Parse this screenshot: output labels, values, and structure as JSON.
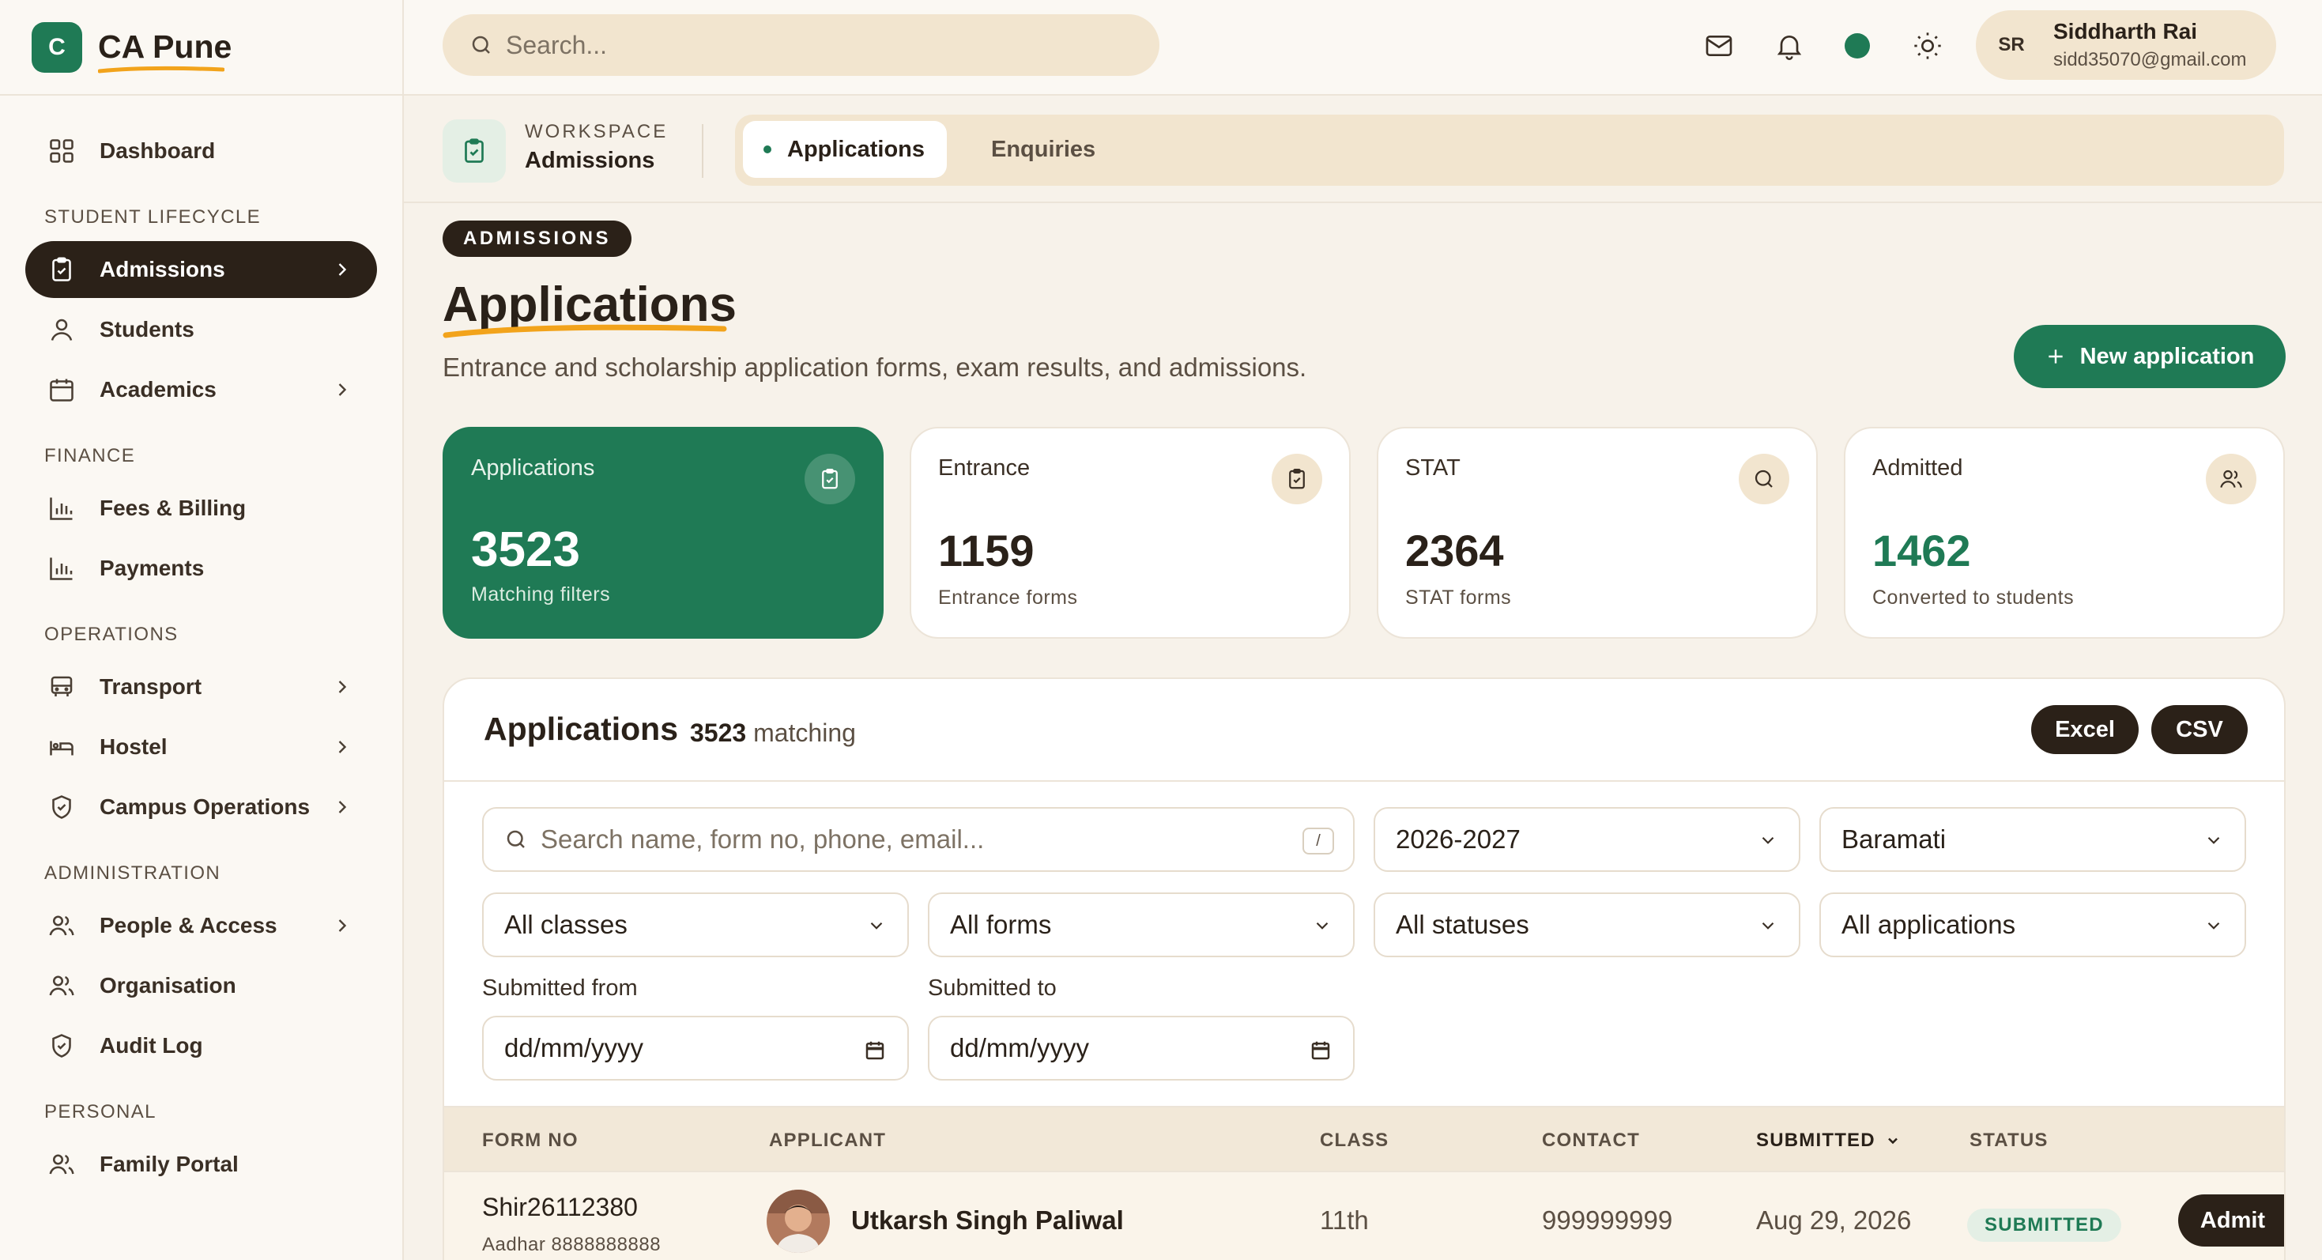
{
  "brand": {
    "logo_letter": "C",
    "name": "CA Pune",
    "accent": "#1f7a55",
    "underline_color": "#f2a31b"
  },
  "sidebar": {
    "dashboard": "Dashboard",
    "sections": {
      "student_lifecycle": "STUDENT LIFECYCLE",
      "finance": "FINANCE",
      "operations": "OPERATIONS",
      "administration": "ADMINISTRATION",
      "personal": "PERSONAL"
    },
    "items": {
      "admissions": "Admissions",
      "students": "Students",
      "academics": "Academics",
      "fees_billing": "Fees & Billing",
      "payments": "Payments",
      "transport": "Transport",
      "hostel": "Hostel",
      "campus_operations": "Campus Operations",
      "people_access": "People & Access",
      "organisation": "Organisation",
      "audit_log": "Audit Log",
      "family_portal": "Family Portal"
    }
  },
  "topbar": {
    "search_placeholder": "Search...",
    "icons": [
      "mail-icon",
      "bell-icon",
      "status-dot",
      "sun-icon"
    ],
    "user": {
      "initials": "SR",
      "name": "Siddharth Rai",
      "email": "sidd35070@gmail.com"
    }
  },
  "workspace": {
    "label": "WORKSPACE",
    "title": "Admissions",
    "tabs": {
      "active": "Applications",
      "other": "Enquiries"
    }
  },
  "page": {
    "badge": "ADMISSIONS",
    "title": "Applications",
    "subtitle": "Entrance and scholarship application forms, exam results, and admissions.",
    "new_button": "New application"
  },
  "stats": [
    {
      "label": "Applications",
      "value": "3523",
      "hint": "Matching filters",
      "icon": "clipboard-check-icon"
    },
    {
      "label": "Entrance",
      "value": "1159",
      "hint": "Entrance forms",
      "icon": "clipboard-check-icon"
    },
    {
      "label": "STAT",
      "value": "2364",
      "hint": "STAT forms",
      "icon": "search-icon"
    },
    {
      "label": "Admitted",
      "value": "1462",
      "hint": "Converted to students",
      "icon": "users-icon"
    }
  ],
  "panel": {
    "title": "Applications",
    "count": "3523",
    "count_suffix": "matching",
    "export_excel": "Excel",
    "export_csv": "CSV",
    "filters": {
      "search_placeholder": "Search name, form no, phone, email...",
      "search_shortcut": "/",
      "year": "2026-2027",
      "campus": "Baramati",
      "classes": "All classes",
      "forms": "All forms",
      "statuses": "All statuses",
      "applications": "All applications",
      "submitted_from_label": "Submitted from",
      "submitted_to_label": "Submitted to",
      "date_placeholder": "dd/mm/yyyy"
    },
    "columns": [
      "FORM NO",
      "APPLICANT",
      "CLASS",
      "CONTACT",
      "SUBMITTED",
      "STATUS"
    ],
    "rows": [
      {
        "form_no": "Shir26112380",
        "aadhar": "Aadhar 8888888888",
        "applicant": "Utkarsh Singh Paliwal",
        "class": "11th",
        "contact": "999999999",
        "submitted": "Aug 29, 2026",
        "status": "SUBMITTED",
        "action": "Admit"
      }
    ]
  }
}
